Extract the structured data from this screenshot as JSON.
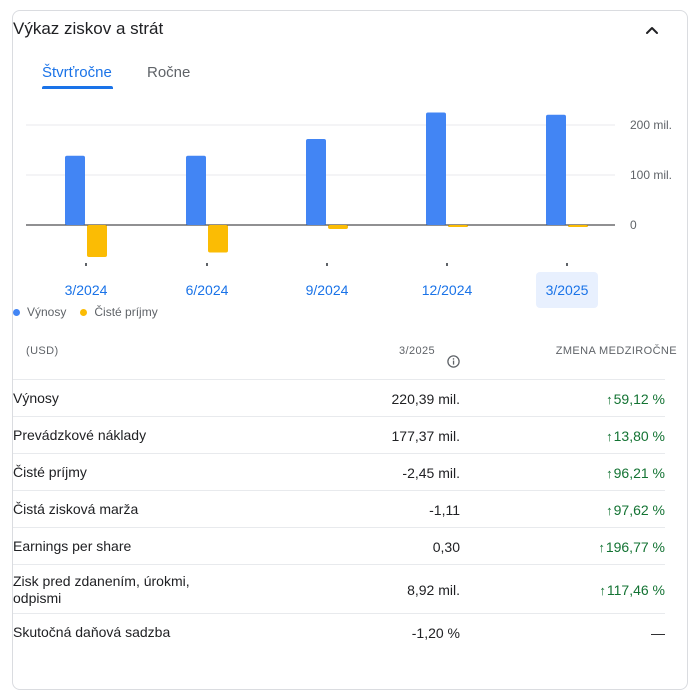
{
  "header": {
    "title": "Výkaz ziskov a strát"
  },
  "tabs": [
    {
      "label": "Štvrťročne",
      "active": true
    },
    {
      "label": "Ročne",
      "active": false
    }
  ],
  "chart_data": {
    "type": "bar",
    "categories": [
      "3/2024",
      "6/2024",
      "9/2024",
      "12/2024",
      "3/2025"
    ],
    "selected_category": "3/2025",
    "series": [
      {
        "name": "Výnosy",
        "color": "#4285f4",
        "values": [
          138.5,
          138.5,
          172,
          225,
          220.39
        ]
      },
      {
        "name": "Čisté príjmy",
        "color": "#fbbc04",
        "values": [
          -64,
          -55,
          -8,
          -4,
          -2.45
        ]
      }
    ],
    "y_ticks": [
      "200 mil.",
      "100 mil.",
      "0"
    ],
    "y_tick_values": [
      200,
      100,
      0
    ],
    "ylim": [
      -80,
      230
    ],
    "grid": true
  },
  "legend": [
    {
      "label": "Výnosy",
      "color": "#4285f4"
    },
    {
      "label": "Čisté príjmy",
      "color": "#fbbc04"
    }
  ],
  "table": {
    "currency": "(USD)",
    "period": "3/2025",
    "change_header": "ZMENA MEDZIROČNE",
    "rows": [
      {
        "label": "Výnosy",
        "value": "220,39 mil.",
        "change": "59,12 %",
        "trend": "up"
      },
      {
        "label": "Prevádzkové náklady",
        "value": "177,37 mil.",
        "change": "13,80 %",
        "trend": "up"
      },
      {
        "label": "Čisté príjmy",
        "value": "-2,45 mil.",
        "change": "96,21 %",
        "trend": "up"
      },
      {
        "label": "Čistá zisková marža",
        "value": "-1,11",
        "change": "97,62 %",
        "trend": "up"
      },
      {
        "label": "Earnings per share",
        "value": "0,30",
        "change": "196,77 %",
        "trend": "up"
      },
      {
        "label": "Zisk pred zdanením, úrokmi, odpismi",
        "value": "8,92 mil.",
        "change": "117,46 %",
        "trend": "up"
      },
      {
        "label": "Skutočná daňová sadzba",
        "value": "-1,20 %",
        "change": "—",
        "trend": "none"
      }
    ]
  }
}
